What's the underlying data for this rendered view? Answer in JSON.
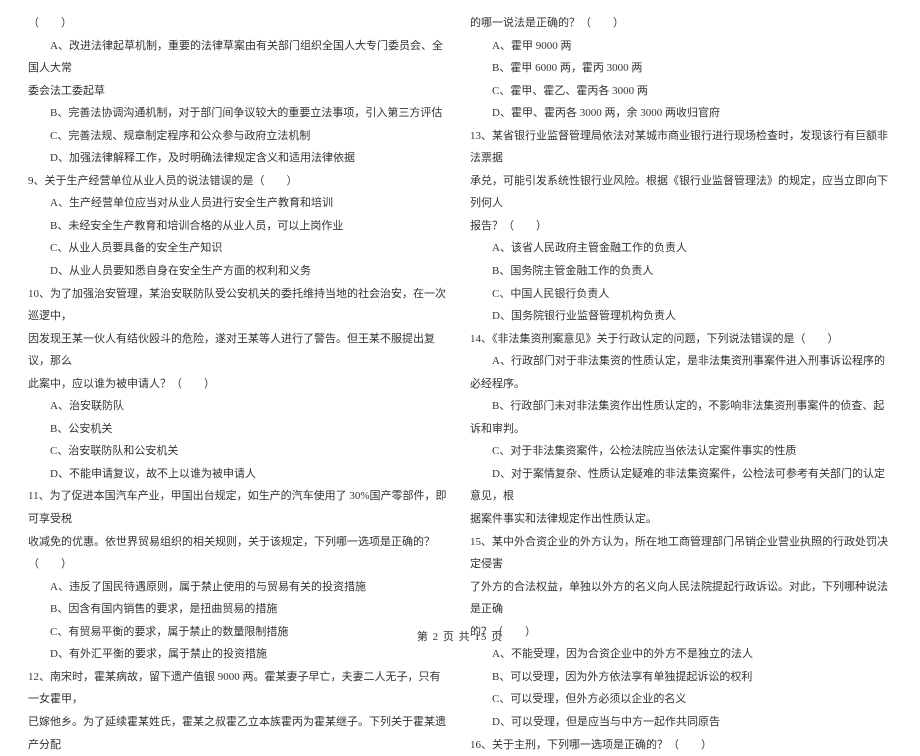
{
  "left": {
    "l0": "（　　）",
    "l1": "A、改进法律起草机制，重要的法律草案由有关部门组织全国人大专门委员会、全国人大常",
    "l2": "委会法工委起草",
    "l3": "B、完善法协调沟通机制，对于部门间争议较大的重要立法事项，引入第三方评估",
    "l4": "C、完善法规、规章制定程序和公众参与政府立法机制",
    "l5": "D、加强法律解释工作，及时明确法律规定含义和适用法律依据",
    "l6": "9、关于生产经营单位从业人员的说法错误的是（　　）",
    "l7": "A、生产经营单位应当对从业人员进行安全生产教育和培训",
    "l8": "B、未经安全生产教育和培训合格的从业人员，可以上岗作业",
    "l9": "C、从业人员要具备的安全生产知识",
    "l10": "D、从业人员要知悉自身在安全生产方面的权利和义务",
    "l11": "10、为了加强治安管理，某治安联防队受公安机关的委托维持当地的社会治安，在一次巡逻中，",
    "l12": "因发现王某一伙人有结伙殴斗的危险，遂对王某等人进行了警告。但王某不服提出复议，那么",
    "l13": "此案中，应以谁为被申请人？（　　）",
    "l14": "A、治安联防队",
    "l15": "B、公安机关",
    "l16": "C、治安联防队和公安机关",
    "l17": "D、不能申请复议，故不上以谁为被申请人",
    "l18": "11、为了促进本国汽车产业，甲国出台规定，如生产的汽车使用了 30%国产零部件，即可享受税",
    "l19": "收减免的优惠。依世界贸易组织的相关规则，关于该规定，下列哪一选项是正确的？（　　）",
    "l20": "A、违反了国民待遇原则，属于禁止使用的与贸易有关的投资措施",
    "l21": "B、因含有国内销售的要求，是扭曲贸易的措施",
    "l22": "C、有贸易平衡的要求，属于禁止的数量限制措施",
    "l23": "D、有外汇平衡的要求，属于禁止的投资措施",
    "l24": "12、南宋时，霍某病故，留下遗产值银 9000 两。霍某妻子早亡，夫妻二人无子，只有一女霍甲，",
    "l25": "已嫁他乡。为了延续霍某姓氏，霍某之叔霍乙立本族霍丙为霍某继子。下列关于霍某遗产分配"
  },
  "right": {
    "r0": "的哪一说法是正确的？（　　）",
    "r1": "A、霍甲 9000 两",
    "r2": "B、霍甲 6000 两，霍丙 3000 两",
    "r3": "C、霍甲、霍乙、霍丙各 3000 两",
    "r4": "D、霍甲、霍丙各 3000 两，余 3000 两收归官府",
    "r5": "13、某省银行业监督管理局依法对某城市商业银行进行现场检查时，发现该行有巨额非法票据",
    "r6": "承兑，可能引发系统性银行业风险。根据《银行业监督管理法》的规定，应当立即向下列何人",
    "r7": "报告？（　　）",
    "r8": "A、该省人民政府主管金融工作的负责人",
    "r9": "B、国务院主管金融工作的负责人",
    "r10": "C、中国人民银行负责人",
    "r11": "D、国务院银行业监督管理机构负责人",
    "r12": "14、《非法集资刑案意见》关于行政认定的问题，下列说法错误的是（　　）",
    "r13": "A、行政部门对于非法集资的性质认定，是非法集资刑事案件进入刑事诉讼程序的必经程序。",
    "r14": "B、行政部门未对非法集资作出性质认定的，不影响非法集资刑事案件的侦查、起诉和审判。",
    "r15": "C、对于非法集资案件，公检法院应当依法认定案件事实的性质",
    "r16": "D、对于案情复杂、性质认定疑难的非法集资案件，公检法可参考有关部门的认定意见，根",
    "r17": "据案件事实和法律规定作出性质认定。",
    "r18": "15、某中外合资企业的外方认为，所在地工商管理部门吊销企业营业执照的行政处罚决定侵害",
    "r19": "了外方的合法权益，单独以外方的名义向人民法院提起行政诉讼。对此，下列哪种说法是正确",
    "r20": "的？（　　）",
    "r21": "A、不能受理，因为合资企业中的外方不是独立的法人",
    "r22": "B、可以受理，因为外方依法享有单独提起诉讼的权利",
    "r23": "C、可以受理，但外方必须以企业的名义",
    "r24": "D、可以受理，但是应当与中方一起作共同原告",
    "r25": "16、关于主刑，下列哪一选项是正确的？（　　）"
  },
  "footer": "第 2 页 共 15 页"
}
